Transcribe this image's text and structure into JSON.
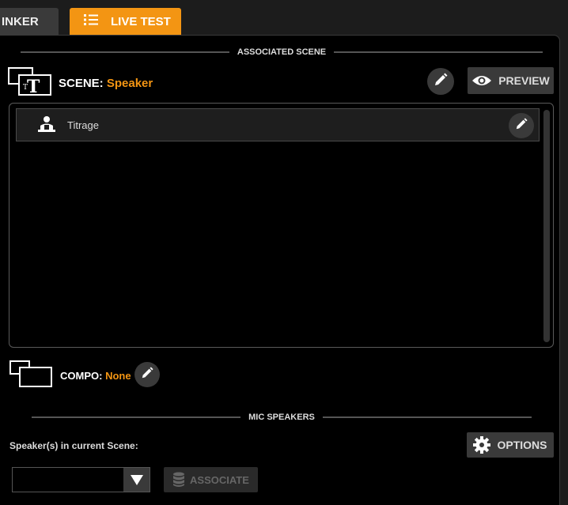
{
  "tabs": [
    {
      "label": "INKER"
    },
    {
      "label": "LIVE TEST"
    }
  ],
  "associated_scene": {
    "header": "ASSOCIATED SCENE",
    "scene_prefix": "SCENE:",
    "scene_name": "Speaker",
    "preview_label": "PREVIEW",
    "items": [
      {
        "name": "Titrage"
      }
    ]
  },
  "compo": {
    "prefix": "COMPO:",
    "value": "None"
  },
  "mic_speakers": {
    "header": "MIC SPEAKERS",
    "options_label": "OPTIONS",
    "speakers_label": "Speaker(s) in current Scene:",
    "select_value": "",
    "associate_label": "ASSOCIATE"
  },
  "colors": {
    "accent": "#f39513",
    "panel_bg": "#000000",
    "button_bg": "#3a3a3a"
  },
  "icons": [
    "list-icon",
    "scene-title-icon",
    "pencil-icon",
    "eye-icon",
    "speaker-person-icon",
    "compo-icon",
    "gear-icon",
    "caret-down-icon",
    "database-icon"
  ]
}
